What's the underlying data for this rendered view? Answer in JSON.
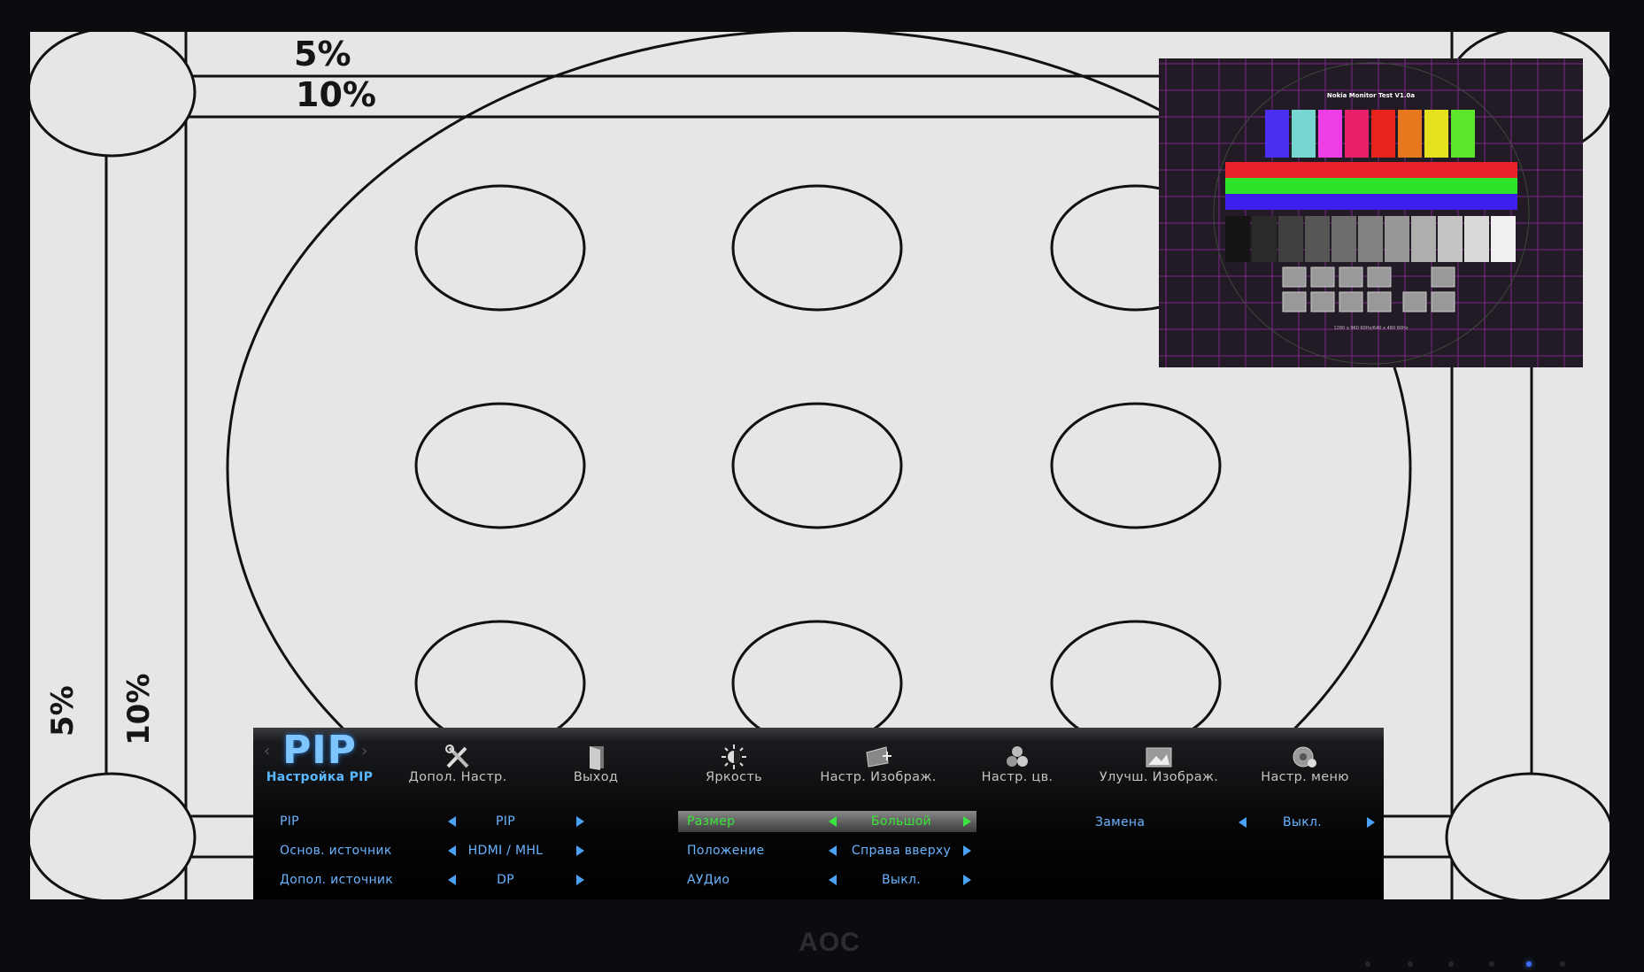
{
  "test_pattern": {
    "label_5": "5%",
    "label_10": "10%"
  },
  "pip_window": {
    "title": "Nokia Monitor Test V1.0a",
    "footer": "1280 x 960 60Hz/640 x 480 60Hz",
    "color_bars": [
      "#4b2ff0",
      "#77d6d0",
      "#f03ee6",
      "#e8206a",
      "#e8231b",
      "#e8781d",
      "#e5e21d",
      "#5ee62c"
    ]
  },
  "osd": {
    "accent_color": "#5bb8ff",
    "selected_color": "#39e63a",
    "pip_big": "PIP",
    "menu": [
      {
        "label": "Настройка PIP",
        "icon": "pip-icon"
      },
      {
        "label": "Допол. Настр.",
        "icon": "tools-icon"
      },
      {
        "label": "Выход",
        "icon": "exit-door-icon"
      },
      {
        "label": "Яркость",
        "icon": "brightness-icon"
      },
      {
        "label": "Настр. Изображ.",
        "icon": "picture-setup-icon"
      },
      {
        "label": "Настр. цв.",
        "icon": "color-setup-icon"
      },
      {
        "label": "Улучш. Изображ.",
        "icon": "picture-boost-icon"
      },
      {
        "label": "Настр. меню",
        "icon": "osd-setup-icon"
      }
    ],
    "settings": {
      "pip": {
        "key": "PIP",
        "value": "PIP"
      },
      "main_source": {
        "key": "Основ. источник",
        "value": "HDMI / MHL"
      },
      "sub_source": {
        "key": "Допол. источник",
        "value": "DP"
      },
      "size": {
        "key": "Размер",
        "value": "Большой"
      },
      "position": {
        "key": "Положение",
        "value": "Справа вверху"
      },
      "audio": {
        "key": "АУДио",
        "value": "Выкл."
      },
      "swap": {
        "key": "Замена",
        "value": "Выкл."
      }
    }
  },
  "brand": "AOC"
}
